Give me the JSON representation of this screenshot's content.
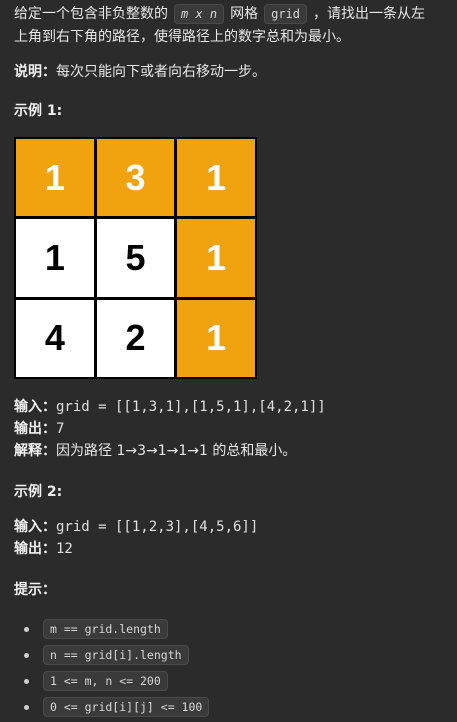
{
  "description": {
    "line1_prefix": "给定一个包含非负整数的",
    "line1_mxn": "m x n",
    "line1_mid": "网格",
    "line1_grid": "grid",
    "line1_suffix": "，请找出一条从左",
    "line2": "上角到右下角的路径，使得路径上的数字总和为最小。"
  },
  "note": {
    "label": "说明：",
    "text": "每次只能向下或者向右移动一步。"
  },
  "example1": {
    "heading": "示例 1:",
    "grid": [
      {
        "value": "1",
        "highlighted": true
      },
      {
        "value": "3",
        "highlighted": true
      },
      {
        "value": "1",
        "highlighted": true
      },
      {
        "value": "1",
        "highlighted": false
      },
      {
        "value": "5",
        "highlighted": false
      },
      {
        "value": "1",
        "highlighted": true
      },
      {
        "value": "4",
        "highlighted": false
      },
      {
        "value": "2",
        "highlighted": false
      },
      {
        "value": "1",
        "highlighted": true
      }
    ],
    "input_label": "输入：",
    "input_value": "grid = [[1,3,1],[1,5,1],[4,2,1]]",
    "output_label": "输出：",
    "output_value": "7",
    "explain_label": "解释：",
    "explain_value": "因为路径 1→3→1→1→1 的总和最小。"
  },
  "example2": {
    "heading": "示例 2:",
    "input_label": "输入：",
    "input_value": "grid = [[1,2,3],[4,5,6]]",
    "output_label": "输出：",
    "output_value": "12"
  },
  "hints": {
    "heading": "提示：",
    "items": [
      "m == grid.length",
      "n == grid[i].length",
      "1 <= m, n <= 200",
      "0 <= grid[i][j] <= 100"
    ]
  },
  "colors": {
    "background": "#2b2b2b",
    "highlight": "#f0a30f",
    "cell": "#ffffff"
  }
}
